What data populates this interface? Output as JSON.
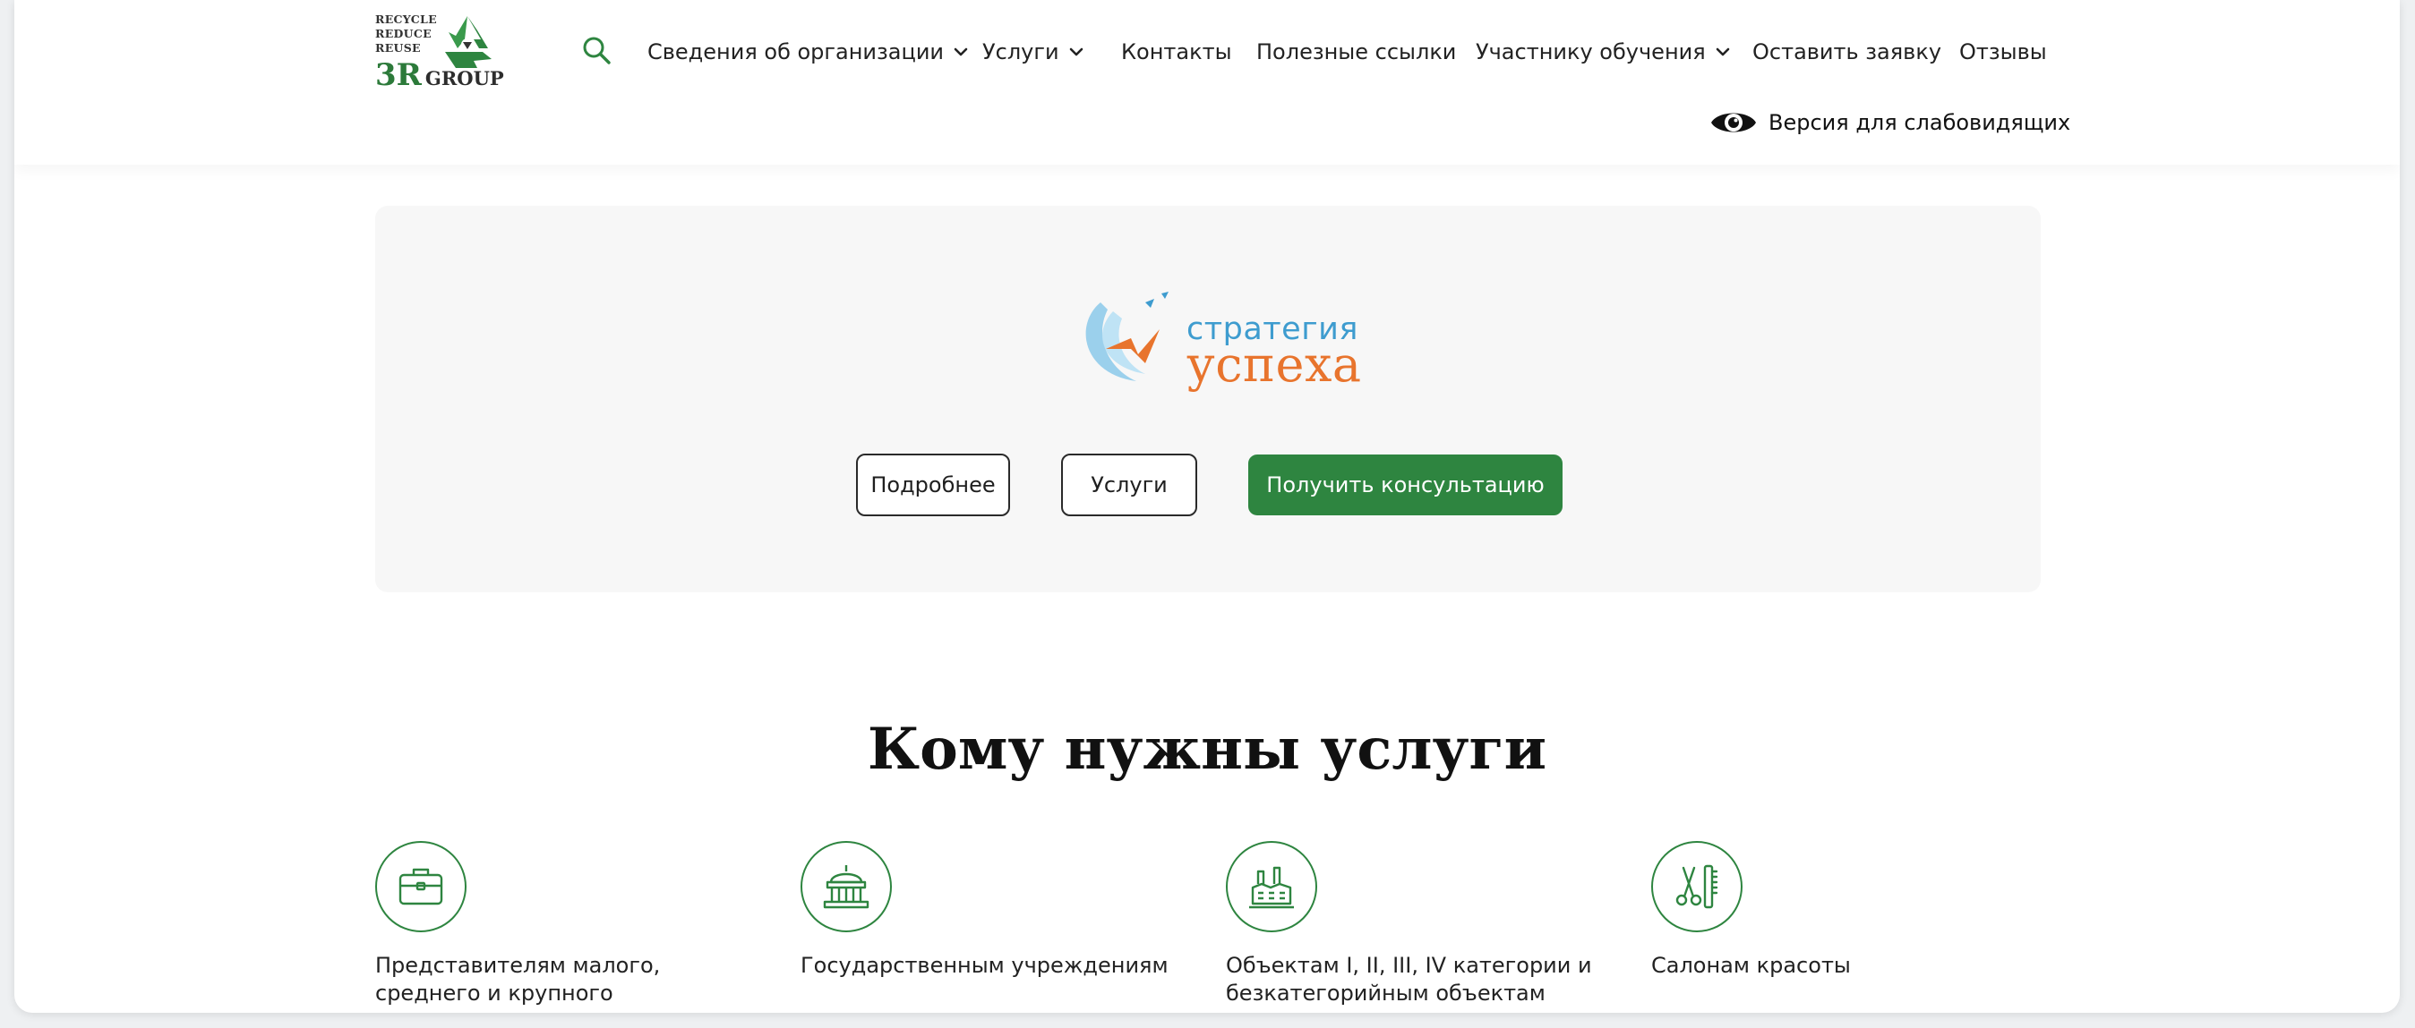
{
  "logo": {
    "lines": [
      "RECYCLE",
      "REDUCE",
      "REUSE"
    ],
    "big": "3R",
    "group": "GROUP",
    "icon": "recycle-icon"
  },
  "header": {
    "search_icon": "search-icon",
    "nav": [
      {
        "label": "Сведения об организации",
        "dropdown": true
      },
      {
        "label": "Услуги",
        "dropdown": true
      },
      {
        "label": "Контакты",
        "dropdown": false
      },
      {
        "label": "Полезные ссылки",
        "dropdown": false
      },
      {
        "label": "Участнику обучения",
        "dropdown": true
      },
      {
        "label": "Оставить заявку",
        "dropdown": false
      },
      {
        "label": "Отзывы",
        "dropdown": false
      }
    ],
    "vision_label": "Версия для слабовидящих",
    "vision_icon": "eye-icon"
  },
  "hero": {
    "brand_top": "стратегия",
    "brand_bottom": "успеха",
    "buttons": {
      "details": "Подробнее",
      "services": "Услуги",
      "consult": "Получить консультацию"
    }
  },
  "audience": {
    "title": "Кому нужны услуги",
    "cards": [
      {
        "icon": "briefcase-icon",
        "text": "Представителям малого, среднего и крупного предпринимательства"
      },
      {
        "icon": "government-building-icon",
        "text": "Государственным учреждениям"
      },
      {
        "icon": "factory-icon",
        "text": "Объектам I, II, III, IV категории и безкатегорийным объектам"
      },
      {
        "icon": "scissors-comb-icon",
        "text": "Салонам красоты"
      }
    ]
  },
  "colors": {
    "accent": "#2e8540",
    "brand_blue": "#3e9ccf",
    "brand_orange": "#e8742d",
    "hero_bg": "#f7f7f7"
  }
}
